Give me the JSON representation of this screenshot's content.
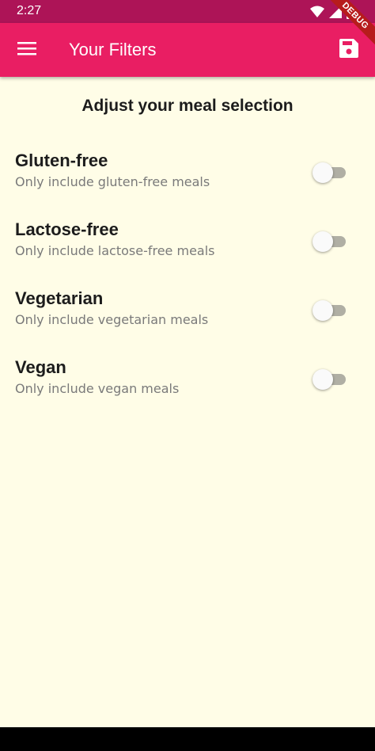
{
  "status_bar": {
    "time": "2:27",
    "icons": [
      "wifi-icon",
      "signal-icon",
      "battery-icon"
    ],
    "color": "#ad1457"
  },
  "debug_banner": "DEBUG",
  "app_bar": {
    "title": "Your Filters",
    "menu_icon": "menu-icon",
    "save_icon": "save-icon",
    "color": "#e91e63"
  },
  "page": {
    "heading": "Adjust your meal selection",
    "background": "#fffde7"
  },
  "filters": [
    {
      "title": "Gluten-free",
      "subtitle": "Only include gluten-free meals",
      "enabled": false
    },
    {
      "title": "Lactose-free",
      "subtitle": "Only include lactose-free meals",
      "enabled": false
    },
    {
      "title": "Vegetarian",
      "subtitle": "Only include vegetarian meals",
      "enabled": false
    },
    {
      "title": "Vegan",
      "subtitle": "Only include vegan meals",
      "enabled": false
    }
  ]
}
